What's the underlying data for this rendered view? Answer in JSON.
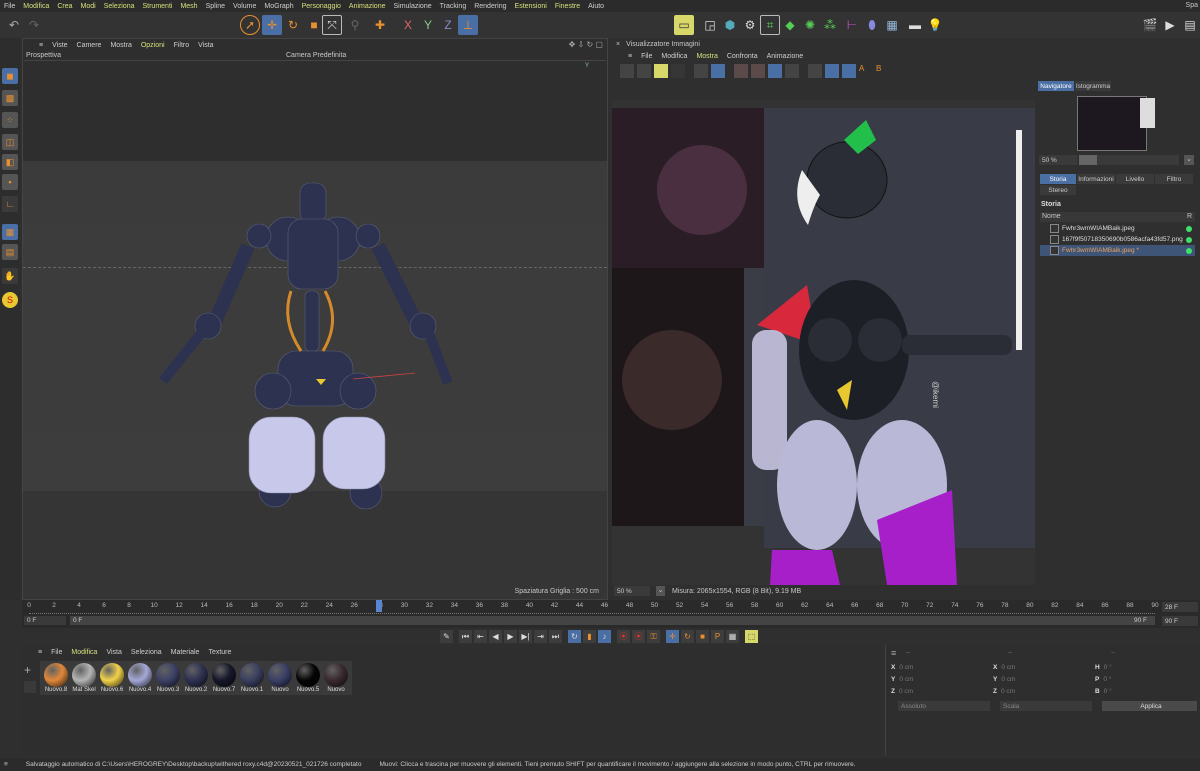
{
  "menu": [
    "File",
    "Modifica",
    "Crea",
    "Modi",
    "Seleziona",
    "Strumenti",
    "Mesh",
    "Spline",
    "Volume",
    "MoGraph",
    "Personaggio",
    "Animazione",
    "Simulazione",
    "Tracking",
    "Rendering",
    "Estensioni",
    "Finestre",
    "Aiuto"
  ],
  "menu_highlighted": [
    1,
    2,
    3,
    4,
    5,
    6,
    10,
    11,
    15,
    16
  ],
  "menu_right": "Spa",
  "viewport": {
    "menu": [
      "Viste",
      "Camere",
      "Mostra",
      "Opzioni",
      "Filtro",
      "Vista"
    ],
    "view_name": "Prospettiva",
    "camera": "Camera Predefinita",
    "grid_spacing": "Spaziatura Griglia : 500 cm"
  },
  "image_viewer": {
    "title": "Visualizzatore Immagini",
    "menu": [
      "File",
      "Modifica",
      "Mostra",
      "Confronta",
      "Animazione"
    ],
    "zoom": "50 %",
    "info": "Misura: 2065x1554, RGB (8 Bit), 9.19 MB",
    "watermark": "@ikemi"
  },
  "right_panel": {
    "tabs": [
      "Navigatore",
      "Istogramma"
    ],
    "zoom": "50 %",
    "subtabs": [
      "Storia",
      "Informazioni",
      "Livello",
      "Filtro",
      "Stereo"
    ],
    "section": "Storia",
    "col_name": "Nome",
    "col_r": "R",
    "history": [
      {
        "name": "Fwhr3wmWIAMBaik.jpeg",
        "selected": false
      },
      {
        "name": "167f9f50718350690b0586acfa43fd57.png",
        "selected": false
      },
      {
        "name": "Fwhr3wmWIAMBaik.jpeg *",
        "selected": true
      }
    ]
  },
  "timeline": {
    "start": 0,
    "end": 90,
    "step": 2,
    "current": 28,
    "field_start": "0 F",
    "field_range": "0 F",
    "end_label": "90 F",
    "current_field": "28 F",
    "end_field": "90 F"
  },
  "materials": {
    "menu": [
      "File",
      "Modifica",
      "Vista",
      "Seleziona",
      "Materiale",
      "Texture"
    ],
    "items": [
      {
        "name": "Nuovo.8",
        "color": "#e0883a"
      },
      {
        "name": "Mat Skel",
        "color": "#b5b5b5"
      },
      {
        "name": "Nuovo.6",
        "color": "#f2d24a"
      },
      {
        "name": "Nuovo.4",
        "color": "#a4a8d8"
      },
      {
        "name": "Nuovo.3",
        "color": "#3d4266"
      },
      {
        "name": "Nuovo.2",
        "color": "#2e3252"
      },
      {
        "name": "Nuovo.7",
        "color": "#16172a"
      },
      {
        "name": "Nuovo.1",
        "color": "#3a3f60"
      },
      {
        "name": "Nuovo",
        "color": "#3a3f66"
      },
      {
        "name": "Nuovo.5",
        "color": "#050505"
      },
      {
        "name": "Nuovo",
        "color": "#3a2a30"
      }
    ]
  },
  "coords": {
    "headers": [
      "--",
      "--",
      "--"
    ],
    "rows": [
      [
        {
          "l": "X",
          "v": "0 cm"
        },
        {
          "l": "X",
          "v": "0 cm"
        },
        {
          "l": "H",
          "v": "0 °"
        }
      ],
      [
        {
          "l": "Y",
          "v": "0 cm"
        },
        {
          "l": "Y",
          "v": "0 cm"
        },
        {
          "l": "P",
          "v": "0 °"
        }
      ],
      [
        {
          "l": "Z",
          "v": "0 cm"
        },
        {
          "l": "Z",
          "v": "0 cm"
        },
        {
          "l": "B",
          "v": "0 °"
        }
      ]
    ],
    "mode": "Assoluto",
    "scale": "Scala",
    "apply": "Applica"
  },
  "status": {
    "autosave": "Salvataggio automatico di C:\\Users\\HEROGREY\\Desktop\\backup\\withered roxy.c4d@20230521_021726 completato",
    "hint": "Muovi: Clicca e trascina per muovere gli elementi. Tieni premuto SHIFT per quantificare il movimento / aggiungere alla selezione in modo punto, CTRL per rimuovere."
  }
}
